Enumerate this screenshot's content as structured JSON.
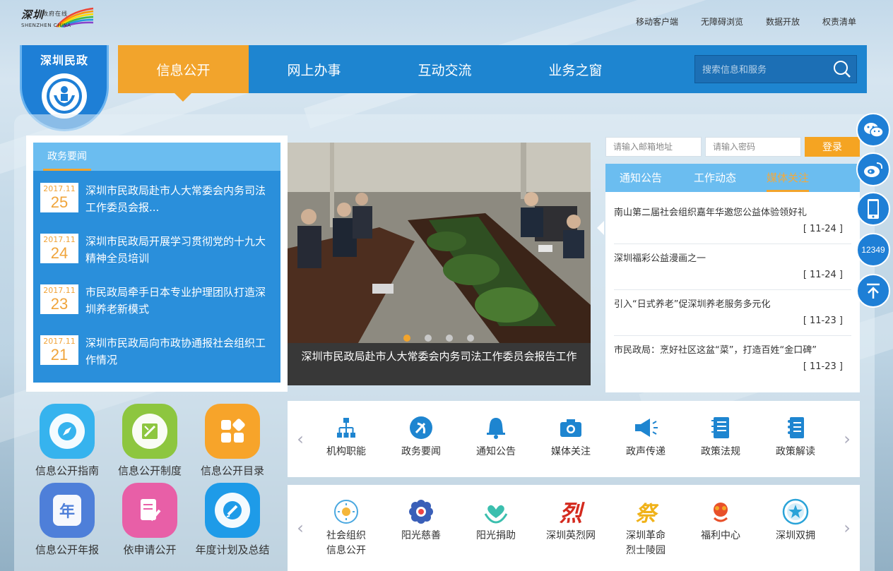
{
  "header": {
    "logo_line1": "深圳",
    "logo_line1b": "政府在线",
    "logo_line2": "SHENZHEN CHINA",
    "links": [
      "移动客户端",
      "无障碍浏览",
      "数据开放",
      "权责清单"
    ]
  },
  "badge": {
    "title": "深圳民政"
  },
  "nav": {
    "items": [
      "信息公开",
      "网上办事",
      "互动交流",
      "业务之窗"
    ],
    "active": "信息公开",
    "search_placeholder": "搜索信息和服务"
  },
  "news": {
    "heading": "政务要闻",
    "items": [
      {
        "ym": "2017.11",
        "day": "25",
        "title": "深圳市民政局赴市人大常委会内务司法工作委员会报..."
      },
      {
        "ym": "2017.11",
        "day": "24",
        "title": "深圳市民政局开展学习贯彻党的十九大精神全员培训"
      },
      {
        "ym": "2017.11",
        "day": "23",
        "title": "市民政局牵手日本专业护理团队打造深圳养老新模式"
      },
      {
        "ym": "2017.11",
        "day": "21",
        "title": "深圳市民政局向市政协通报社会组织工作情况"
      }
    ]
  },
  "slide": {
    "caption": "深圳市民政局赴市人大常委会内务司法工作委员会报告工作"
  },
  "login": {
    "email_placeholder": "请输入邮箱地址",
    "password_placeholder": "请输入密码",
    "button": "登录"
  },
  "notice": {
    "tabs": [
      "通知公告",
      "工作动态",
      "媒体关注"
    ],
    "active_tab": "媒体关注",
    "items": [
      {
        "title": "南山第二届社会组织嘉年华邀您公益体验领好礼",
        "date": "[ 11-24 ]"
      },
      {
        "title": "深圳福彩公益漫画之一",
        "date": "[ 11-24 ]"
      },
      {
        "title": "引入“日式养老”促深圳养老服务多元化",
        "date": "[ 11-23 ]"
      },
      {
        "title": "市民政局：烹好社区这盆“菜”，打造百姓“金口碑”",
        "date": "[ 11-23 ]"
      }
    ]
  },
  "apps": [
    {
      "label": "信息公开指南",
      "color": "#36b3ee"
    },
    {
      "label": "信息公开制度",
      "color": "#8dc63f"
    },
    {
      "label": "信息公开目录",
      "color": "#f7a42a"
    },
    {
      "label": "信息公开年报",
      "color": "#4e7fd9",
      "glyph": "年"
    },
    {
      "label": "依申请公开",
      "color": "#e85fa7"
    },
    {
      "label": "年度计划及总结",
      "color": "#1e9be8"
    }
  ],
  "services1": [
    "机构职能",
    "政务要闻",
    "通知公告",
    "媒体关注",
    "政声传递",
    "政策法规",
    "政策解读"
  ],
  "services2": [
    {
      "l1": "社会组织",
      "l2": "信息公开"
    },
    {
      "l1": "阳光慈善",
      "l2": ""
    },
    {
      "l1": "阳光捐助",
      "l2": ""
    },
    {
      "l1": "深圳英烈网",
      "l2": ""
    },
    {
      "l1": "深圳革命",
      "l2": "烈士陵园"
    },
    {
      "l1": "福利中心",
      "l2": ""
    },
    {
      "l1": "深圳双拥",
      "l2": ""
    }
  ],
  "svc2_glyphs": {
    "lieshi": "烈",
    "ji": "祭"
  },
  "side": {
    "hotline": "12349"
  },
  "colors": {
    "nav_blue": "#1e85d0",
    "accent_orange": "#f2a42c",
    "news_blue": "#2a8fdb",
    "tab_blue": "#6bbdf0"
  }
}
